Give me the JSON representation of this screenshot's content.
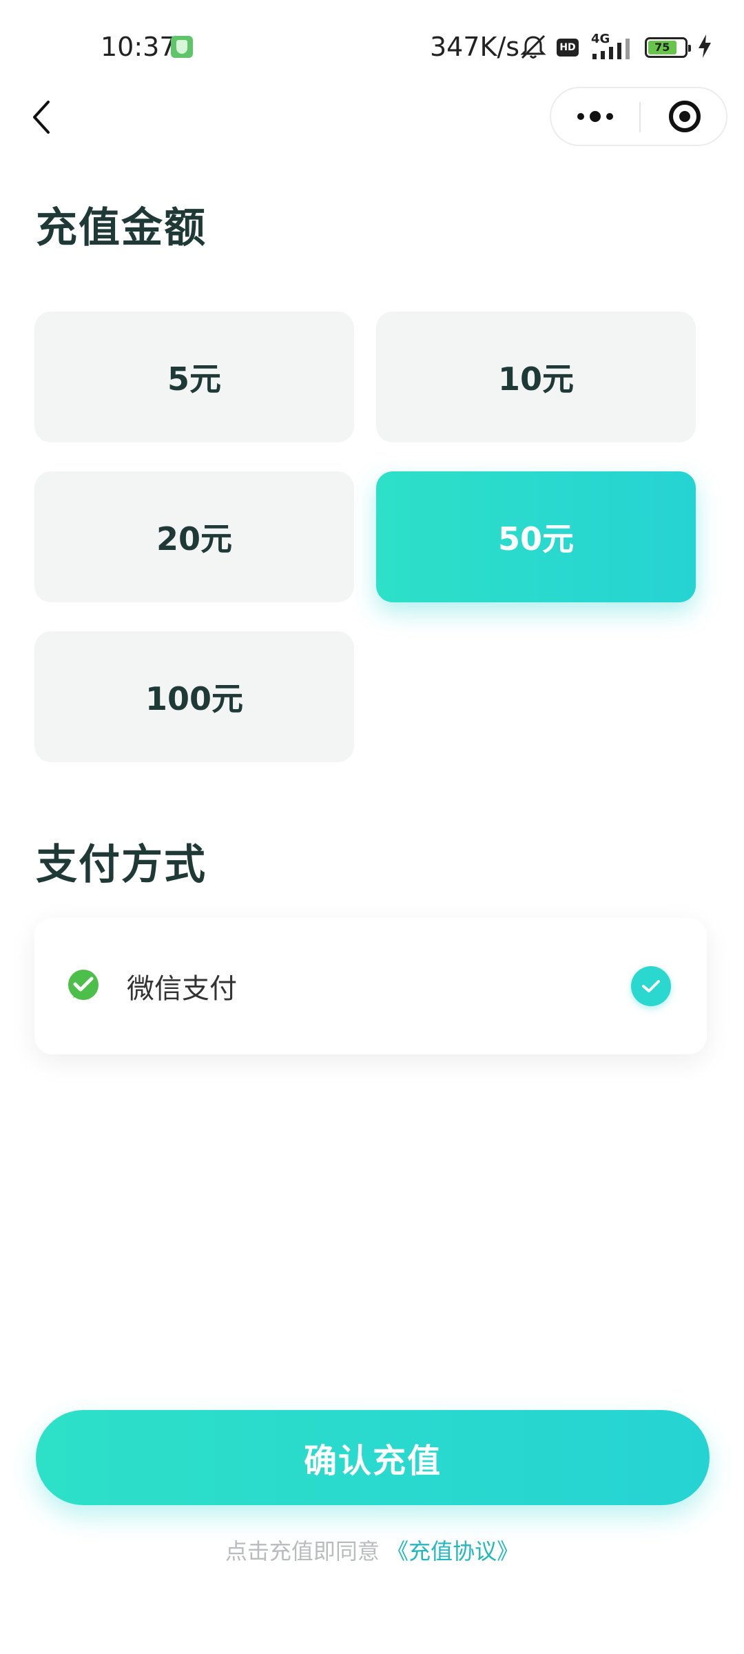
{
  "status_bar": {
    "time": "10:37",
    "net_speed": "347K/s",
    "hd_label": "HD",
    "network": "4G",
    "battery_level": "75",
    "battery_percent": 75
  },
  "nav": {
    "back_icon": "chevron-left-icon",
    "more_icon": "more-dots-icon",
    "close_icon": "target-circle-icon"
  },
  "recharge": {
    "title": "充值金额",
    "options": [
      {
        "label": "5元",
        "selected": false
      },
      {
        "label": "10元",
        "selected": false
      },
      {
        "label": "20元",
        "selected": false
      },
      {
        "label": "50元",
        "selected": true
      },
      {
        "label": "100元",
        "selected": false
      }
    ]
  },
  "payment": {
    "title": "支付方式",
    "method_label": "微信支付",
    "method_icon": "wechat-pay-icon",
    "selected_icon": "check-icon"
  },
  "actions": {
    "confirm_label": "确认充值",
    "agreement_prefix": "点击充值即同意",
    "agreement_link": "《充值协议》"
  },
  "colors": {
    "accent": "#2bd8cf",
    "title_text": "#1f3a36",
    "option_bg": "#f3f5f5",
    "link": "#22b8bf",
    "wechat_green": "#4cbf4a"
  }
}
